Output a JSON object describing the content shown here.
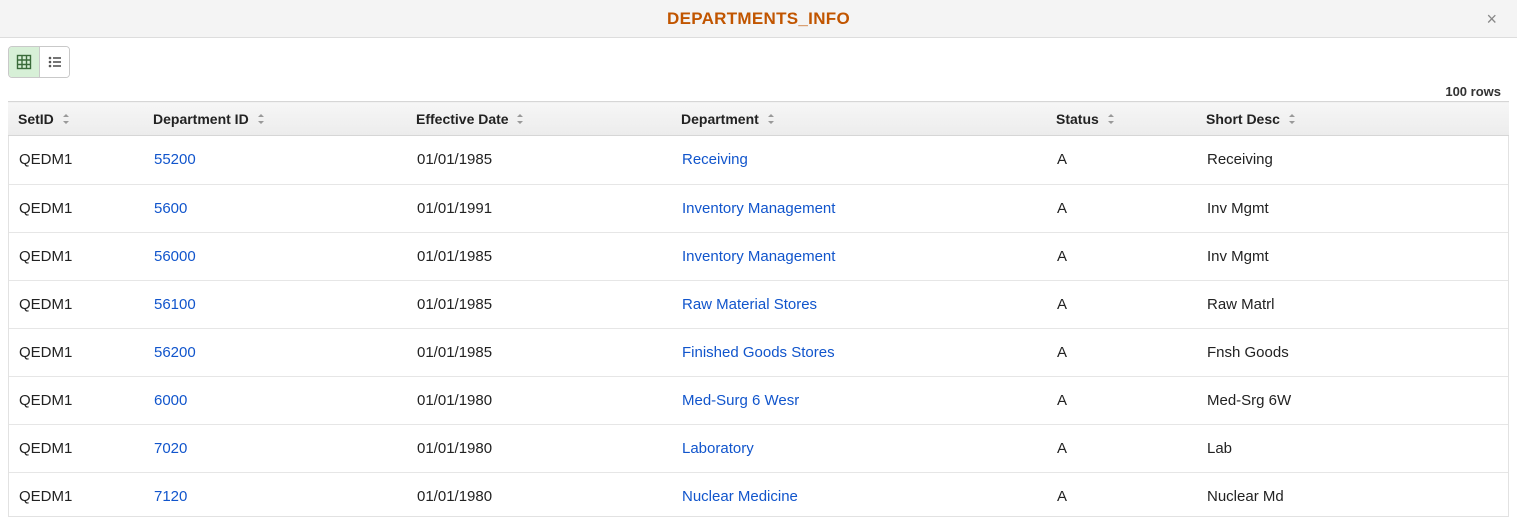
{
  "header": {
    "title": "DEPARTMENTS_INFO",
    "close_label": "×"
  },
  "toolbar": {
    "grid_view_label": "Grid View",
    "list_view_label": "List View",
    "row_count_label": "100 rows"
  },
  "table": {
    "columns": {
      "setid": "SetID",
      "deptid": "Department ID",
      "effdt": "Effective Date",
      "dept": "Department",
      "status": "Status",
      "short": "Short Desc"
    },
    "rows": [
      {
        "setid": "QEDM1",
        "deptid": "55200",
        "effdt": "01/01/1985",
        "dept": "Receiving",
        "status": "A",
        "short": "Receiving"
      },
      {
        "setid": "QEDM1",
        "deptid": "5600",
        "effdt": "01/01/1991",
        "dept": "Inventory Management",
        "status": "A",
        "short": "Inv Mgmt"
      },
      {
        "setid": "QEDM1",
        "deptid": "56000",
        "effdt": "01/01/1985",
        "dept": "Inventory Management",
        "status": "A",
        "short": "Inv Mgmt"
      },
      {
        "setid": "QEDM1",
        "deptid": "56100",
        "effdt": "01/01/1985",
        "dept": "Raw Material Stores",
        "status": "A",
        "short": "Raw Matrl"
      },
      {
        "setid": "QEDM1",
        "deptid": "56200",
        "effdt": "01/01/1985",
        "dept": "Finished Goods Stores",
        "status": "A",
        "short": "Fnsh Goods"
      },
      {
        "setid": "QEDM1",
        "deptid": "6000",
        "effdt": "01/01/1980",
        "dept": "Med-Surg 6 Wesr",
        "status": "A",
        "short": "Med-Srg 6W"
      },
      {
        "setid": "QEDM1",
        "deptid": "7020",
        "effdt": "01/01/1980",
        "dept": "Laboratory",
        "status": "A",
        "short": "Lab"
      },
      {
        "setid": "QEDM1",
        "deptid": "7120",
        "effdt": "01/01/1980",
        "dept": "Nuclear Medicine",
        "status": "A",
        "short": "Nuclear Md"
      }
    ]
  }
}
